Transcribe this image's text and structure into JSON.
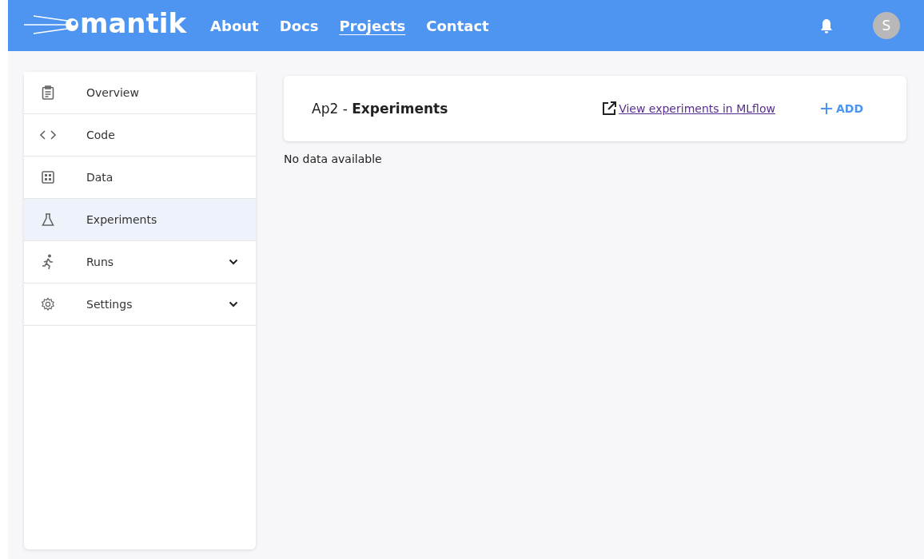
{
  "header": {
    "logo": "mantik",
    "nav": [
      {
        "label": "About",
        "selected": false
      },
      {
        "label": "Docs",
        "selected": false
      },
      {
        "label": "Projects",
        "selected": true
      },
      {
        "label": "Contact",
        "selected": false
      }
    ],
    "avatar": "S"
  },
  "sidebar": {
    "items": [
      {
        "label": "Overview",
        "kind": "link",
        "selected": false
      },
      {
        "label": "Code",
        "kind": "link",
        "selected": false
      },
      {
        "label": "Data",
        "kind": "link",
        "selected": false
      },
      {
        "label": "Experiments",
        "kind": "link",
        "selected": true
      },
      {
        "label": "Runs",
        "kind": "group",
        "selected": false
      },
      {
        "label": "Settings",
        "kind": "group",
        "selected": false
      }
    ]
  },
  "main": {
    "title": "Ap2 - **Experiments**",
    "mlflow_link": "View experiments in MLflow",
    "add_button": "ADD",
    "empty_message": "No data available"
  }
}
